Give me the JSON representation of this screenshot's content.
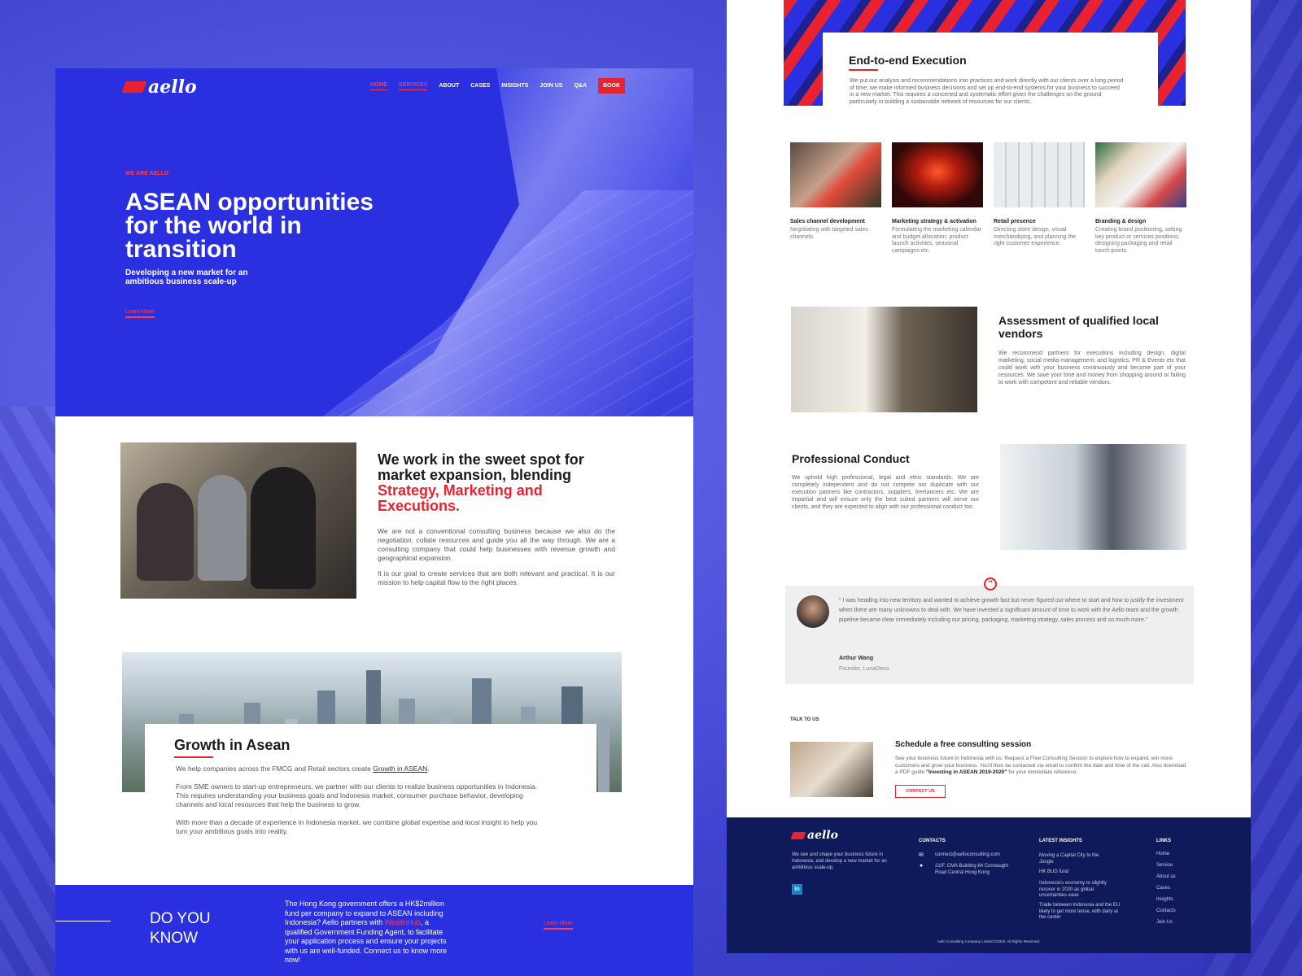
{
  "left": {
    "logo": "aello",
    "nav": [
      {
        "label": "HOME",
        "active": true
      },
      {
        "label": "SERVICES",
        "active": true
      },
      {
        "label": "ABOUT",
        "active": false
      },
      {
        "label": "CASES",
        "active": false
      },
      {
        "label": "INSIGHTS",
        "active": false
      },
      {
        "label": "JOIN US",
        "active": false
      },
      {
        "label": "Q&A",
        "active": false
      }
    ],
    "book": "BOOK",
    "hero": {
      "eyebrow": "WE ARE AELLO",
      "title": "ASEAN opportunities for the world in transition",
      "subtitle": "Developing a new market for an ambitious business scale-up",
      "link": "Learn More"
    },
    "sweet_spot": {
      "title_black": "We work in the sweet spot for market expansion, blending",
      "title_red": "Strategy, Marketing and Executions.",
      "p1": "We are not a conventional consulting business because we also do the negotiation, collate resources and guide you all the way through. We are a consulting company that could help businesses with revenue growth and geographical expansion.",
      "p2": "It is our goal to create services that are both relevant and practical. It is our mission to help capital flow to the right places."
    },
    "growth": {
      "title": "Growth in Asean",
      "p1_prefix": "We help companies across the FMCG and Retail sectors create ",
      "p1_link": "Growth in ASEAN",
      "p1_suffix": ".",
      "p2": "From SME owners to start-up entrepreneurs, we partner with our clients to realize business opportunities in Indonesia. This requires understanding your business goals and Indonesia market, consumer purchase behavior, developing channels and local resources that help the business to grow.",
      "p3": "With more than a decade of experience in Indonesia market, we combine global expertise and local insight to help you turn your ambitious goals into reality."
    },
    "dyk": {
      "title_1": "DO YOU",
      "title_2": "KNOW",
      "text_1": "The Hong Kong government offers a HK$2million fund per company to expand to ASEAN including Indonesia? Aello partners with ",
      "text_link": "WealthHub",
      "text_2": ", a qualified Government Funding Agent, to facilitate your application process and ensure your projects with us are well-funded. Connect us to know more now!",
      "link": "Learn More"
    }
  },
  "right": {
    "exec": {
      "title": "End-to-end Execution",
      "p": "We put our analysis and recommendations into practices and work directly with our clients over a long period of time; we make informed business decisions and set up end-to-end systems for your business to succeed in a new market. This requires a concerted and systematic effort given the challenges on the ground particularly in building a sustainable network of resources for our clients."
    },
    "services": [
      {
        "title": "Sales channel development",
        "desc": "Negotiating with targeted sales channels."
      },
      {
        "title": "Marketing strategy & activation",
        "desc": "Formulating the marketing calendar and budget allocation; product launch activities, seasonal campaigns etc."
      },
      {
        "title": "Retail presence",
        "desc": "Directing store design, visual merchandising, and planning the right customer experience."
      },
      {
        "title": "Branding & design",
        "desc": "Creating brand positioning, setting key product or services positions; designing packaging and retail touch-points."
      }
    ],
    "vendors": {
      "title": "Assessment of qualified local vendors",
      "p": "We recommend partners for executions including design, digital marketing, social media management, and logistics, PR & Events etc that could work with your business continuously and become part of your resources. We save your time and money from shopping around or failing to work with competent and reliable vendors."
    },
    "conduct": {
      "title": "Professional Conduct",
      "p": "We uphold high professional, legal and ethic standards. We are completely independent and do not compete nor duplicate with our execution partners like contractors, suppliers, freelancers etc. We are impartial and will ensure only the best suited partners will serve our clients, and they are expected to align with our professional conduct too."
    },
    "testimonial": {
      "quote": "\" I was heading into new territory and wanted to achieve growth fast but never figured out where to start and how to justify the investment when there are many unknowns to deal with. We have invested a significant amount of time to work with the Aello team and the growth pipeline became clear immediately including our pricing, packaging, marketing strategy, sales process and so much more.\"",
      "name": "Arthur Wang",
      "role": "Founder, LunaDeco"
    },
    "talk": {
      "eyebrow": "TALK TO US",
      "title": "Schedule a free consulting session",
      "p_1": "See your business future in Indonesia with us. Request a Free Consulting Session to explore how to expand, win more customers and grow your business. You'll then be contacted via email to confirm the date and time of the call. Also download a PDF guide ",
      "p_bold": "\"Investing in ASEAN 2019-2020\"",
      "p_2": " for your immediate reference.",
      "button": "CONTACT US"
    },
    "footer": {
      "logo": "aello",
      "about": "We see and shape your business future in Indonesia, and develop a new market for an ambitious scale-up.",
      "social": "in",
      "contacts_h": "CONTACTS",
      "email": "connect@aelloconsulting.com",
      "address": "21/F, CMA Building 64 Connaught Road Central Hong Kong",
      "insights_h": "LATEST INSIGHTS",
      "insights": [
        "Moving a Capital City to the Jungle",
        "HK BUD fund",
        "Indonesia's economy to slightly recover in 2020 as global uncertainties ease",
        "Trade between Indonesia and the EU likely to get more tense, with dairy at the center"
      ],
      "links_h": "LINKS",
      "links": [
        "Home",
        "Service",
        "About us",
        "Cases",
        "Insights",
        "Contacts",
        "Join Us"
      ],
      "copyright": "Aello Consulting Company Limited ©2020. All Rights Reserved."
    }
  },
  "colors": {
    "brand_blue": "#2a2fe0",
    "accent_red": "#e8222f",
    "footer_navy": "#0f1a5a"
  }
}
